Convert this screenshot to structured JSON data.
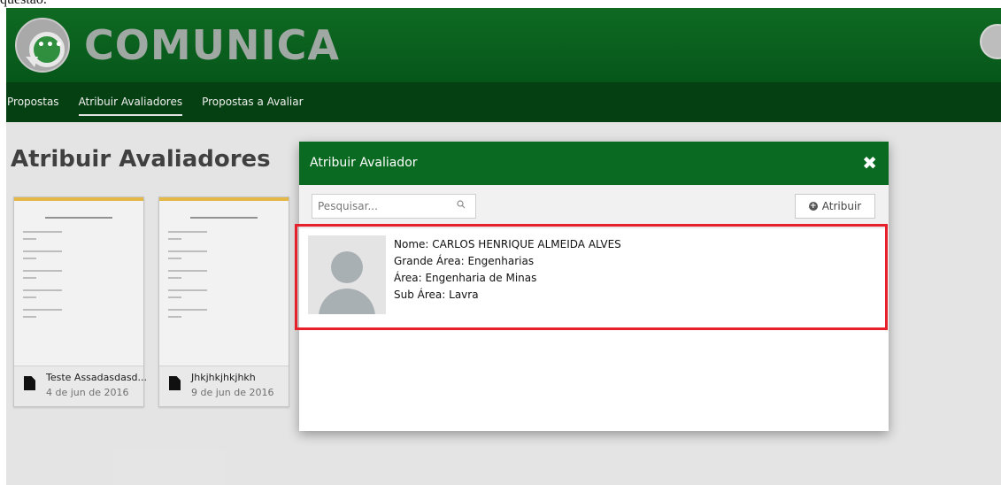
{
  "caption_fragment": "questão.",
  "header": {
    "brand": "COMUNICA",
    "logo_dots": "•••"
  },
  "nav": {
    "items": [
      {
        "label": "Propostas",
        "active": false
      },
      {
        "label": "Atribuir Avaliadores",
        "active": true
      },
      {
        "label": "Propostas a Avaliar",
        "active": false
      }
    ]
  },
  "page": {
    "title": "Atribuir Avaliadores",
    "cards": [
      {
        "name": "Teste Assadasdasd...",
        "date": "4 de jun de 2016"
      },
      {
        "name": "Jhkjhkjhkjhkh",
        "date": "9 de jun de 2016"
      }
    ]
  },
  "modal": {
    "title": "Atribuir Avaliador",
    "close_glyph": "✖",
    "search_placeholder": "Pesquisar...",
    "assign_label": "Atribuir",
    "evaluator": {
      "name_line": "Nome: CARLOS HENRIQUE ALMEIDA ALVES",
      "grande_area_line": "Grande Área: Engenharias",
      "area_line": "Área: Engenharia de Minas",
      "sub_area_line": "Sub Área: Lavra"
    }
  },
  "colors": {
    "header_green": "#0f6a22",
    "nav_green": "#044011",
    "modal_header_green": "#0a6a21",
    "highlight_red": "#e8202a",
    "card_accent": "#f0c24a"
  }
}
